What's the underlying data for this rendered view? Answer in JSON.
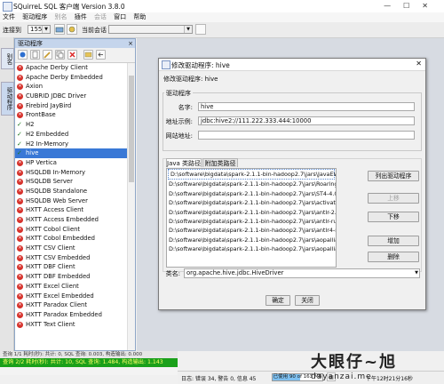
{
  "window": {
    "title": "SQuirreL SQL 客户端 Version 3.8.0",
    "min": "—",
    "max": "☐",
    "close": "✕"
  },
  "menu": [
    {
      "label": "文件",
      "enabled": true
    },
    {
      "label": "驱动程序",
      "enabled": true
    },
    {
      "label": "别名",
      "enabled": false
    },
    {
      "label": "插件",
      "enabled": true
    },
    {
      "label": "会话",
      "enabled": false
    },
    {
      "label": "窗口",
      "enabled": true
    },
    {
      "label": "帮助",
      "enabled": true
    }
  ],
  "toolbar": {
    "connect_label": "连接到",
    "connect_value": "155",
    "current_session_label": "当前会话"
  },
  "side_tabs": {
    "aliases": "别名",
    "drivers": "驱动程序"
  },
  "driver_panel": {
    "title": "驱动程序",
    "close": "×",
    "drivers": [
      {
        "name": "Apache Derby Client",
        "ok": false
      },
      {
        "name": "Apache Derby Embedded",
        "ok": false
      },
      {
        "name": "Axion",
        "ok": false
      },
      {
        "name": "CUBRID JDBC Driver",
        "ok": false
      },
      {
        "name": "Firebird JayBird",
        "ok": false
      },
      {
        "name": "FrontBase",
        "ok": false
      },
      {
        "name": "H2",
        "ok": true
      },
      {
        "name": "H2 Embedded",
        "ok": true
      },
      {
        "name": "H2 In-Memory",
        "ok": true
      },
      {
        "name": "hive",
        "ok": true,
        "selected": true
      },
      {
        "name": "HP Vertica",
        "ok": false
      },
      {
        "name": "HSQLDB In-Memory",
        "ok": false
      },
      {
        "name": "HSQLDB Server",
        "ok": false
      },
      {
        "name": "HSQLDB Standalone",
        "ok": false
      },
      {
        "name": "HSQLDB Web Server",
        "ok": false
      },
      {
        "name": "HXTT Access Client",
        "ok": false
      },
      {
        "name": "HXTT Access Embedded",
        "ok": false
      },
      {
        "name": "HXTT Cobol Client",
        "ok": false
      },
      {
        "name": "HXTT Cobol Embedded",
        "ok": false
      },
      {
        "name": "HXTT CSV Client",
        "ok": false
      },
      {
        "name": "HXTT CSV Embedded",
        "ok": false
      },
      {
        "name": "HXTT DBF Client",
        "ok": false
      },
      {
        "name": "HXTT DBF Embedded",
        "ok": false
      },
      {
        "name": "HXTT Excel Client",
        "ok": false
      },
      {
        "name": "HXTT Excel Embedded",
        "ok": false
      },
      {
        "name": "HXTT Paradox Client",
        "ok": false
      },
      {
        "name": "HXTT Paradox Embedded",
        "ok": false
      },
      {
        "name": "HXTT Text Client",
        "ok": false
      }
    ]
  },
  "dialog": {
    "title": "修改驱动程序: hive",
    "subtitle": "修改驱动程序: hive",
    "group_label": "驱动程序",
    "name_label": "名字:",
    "name_value": "hive",
    "url_label": "地址示例:",
    "url_value": "jdbc:hive2://111.222.333.444:10000",
    "website_label": "网站地址:",
    "website_value": "",
    "tab_java": "Java 类路径",
    "tab_extra": "附加类路径",
    "jars": [
      "D:\\software\\bigdata\\spark-2.1.1-bin-hadoop2.7\\jars\\JavaEWAH-0.3.2.ja",
      "D:\\software\\bigdata\\spark-2.1.1-bin-hadoop2.7\\jars\\RoaringBitmap-0.5",
      "D:\\software\\bigdata\\spark-2.1.1-bin-hadoop2.7\\jars\\ST4-4.0.4.jar",
      "D:\\software\\bigdata\\spark-2.1.1-bin-hadoop2.7\\jars\\activation-1.1.1.jar",
      "D:\\software\\bigdata\\spark-2.1.1-bin-hadoop2.7\\jars\\antlr-2.7.7.jar",
      "D:\\software\\bigdata\\spark-2.1.1-bin-hadoop2.7\\jars\\antlr-runtime-3.4.ja",
      "D:\\software\\bigdata\\spark-2.1.1-bin-hadoop2.7\\jars\\antlr4-runtime-4.5.3",
      "D:\\software\\bigdata\\spark-2.1.1-bin-hadoop2.7\\jars\\aopalliance-1.0.jar",
      "D:\\software\\bigdata\\spark-2.1.1-bin-hadoop2.7\\jars\\aopalliance-repac"
    ],
    "btn_list_drivers": "列出驱动程序",
    "btn_up": "上移",
    "btn_down": "下移",
    "btn_add": "增加",
    "btn_delete": "删除",
    "class_label": "类名:",
    "class_value": "org.apache.hive.jdbc.HiveDriver",
    "ok": "确定",
    "cancel": "关闭"
  },
  "status": {
    "line1": "查询 1/1 耗时(秒): 共计: 0, SQL 查询: 0.003, 构造输出: 0.000",
    "line2": "查询 2/2 耗时(秒): 共计: 10, SQL 查询: 1.484, 构造输出: 1.143",
    "logs": "日志: 错误 34, 警告 0, 信息 45",
    "memory": "已使用 90 of 163 MB",
    "memory_fraction": 0.55,
    "time": "下午12时21分16秒"
  },
  "watermark": {
    "main": "大眼仔~旭",
    "sub": "dayanzai.me"
  },
  "colors": {
    "status_green": "#1aa01a",
    "selection": "#3978d6",
    "driver_error": "#d6312b"
  }
}
